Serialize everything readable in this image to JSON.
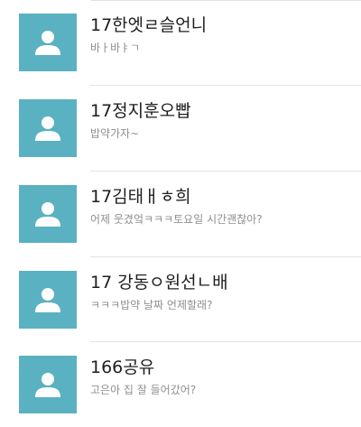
{
  "chats": [
    {
      "name": "17한엣ㄹ슬언니",
      "preview": "바ㅏ바ㅑㄱ",
      "avatar_icon": "person-icon"
    },
    {
      "name": "17정지훈오빱",
      "preview": "밥약가자~",
      "avatar_icon": "person-icon"
    },
    {
      "name": "17김태ㅐㅎ희",
      "preview": "어제 웃겼엌ㅋㅋㅋ토요일 시간괜찮아?",
      "avatar_icon": "person-icon"
    },
    {
      "name": "17 강동ㅇ원선ㄴ배",
      "preview": "ㅋㅋㅋ밥약 날짜 언제할래?",
      "avatar_icon": "person-icon"
    },
    {
      "name": "166공유",
      "preview": "고은아 집 잘 들어갔어?",
      "avatar_icon": "person-icon"
    }
  ],
  "colors": {
    "avatar_bg": "#5ab1c1",
    "avatar_figure": "#ffffff",
    "name_text": "#1e1e1e",
    "preview_text": "#8f8f8f",
    "divider": "#e2e2e2"
  }
}
